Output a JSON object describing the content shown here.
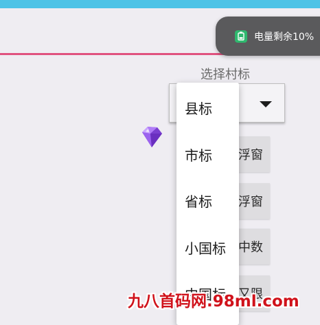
{
  "toast": {
    "icon": "battery-icon",
    "text": "电量剩余10%"
  },
  "select": {
    "label": "选择村标"
  },
  "background_buttons": [
    "浮窗",
    "浮窗",
    "中数",
    "又限"
  ],
  "dropdown": {
    "options": [
      "县标",
      "市标",
      "省标",
      "小国标",
      "中国标"
    ]
  },
  "watermark": "九八首码网.98ml.com",
  "colors": {
    "top_bar": "#4ec3e6",
    "accent_line": "#e0527f",
    "toast_bg": "#5a5a5c",
    "watermark": "#d0121b"
  }
}
